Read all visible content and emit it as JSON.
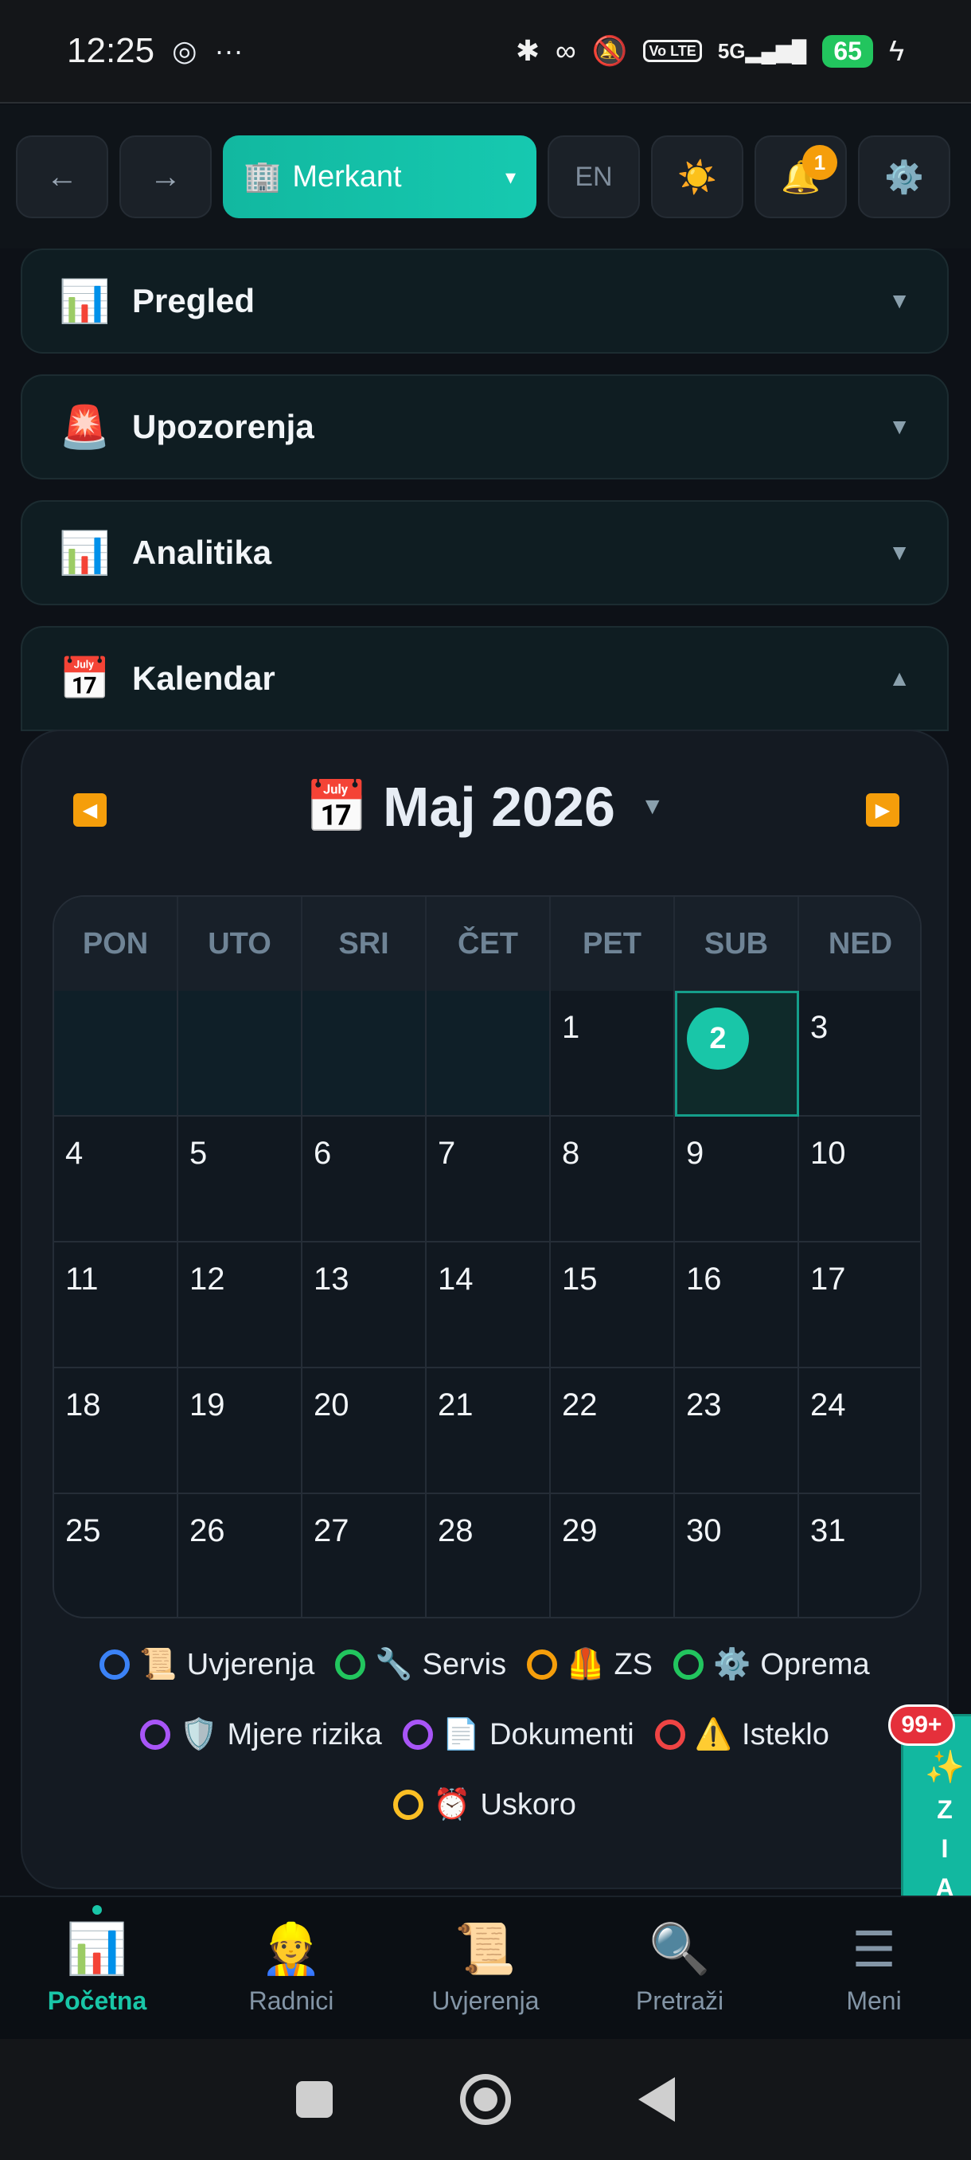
{
  "status_bar": {
    "time": "12:25",
    "icons": [
      "chrome-icon",
      "more-icon",
      "bluetooth-icon",
      "link-icon",
      "mute-icon",
      "volte-icon",
      "signal-5g-icon",
      "battery-icon",
      "charging-icon"
    ],
    "volte": "Vo LTE",
    "network": "5G",
    "battery": "65"
  },
  "topbar": {
    "back": "←",
    "forward": "→",
    "site_icon": "🏢",
    "site": "Merkant",
    "site_caret": "▾",
    "lang": "EN",
    "theme_icon": "☀️",
    "bell_icon": "🔔",
    "bell_badge": "1",
    "settings_icon": "⚙️"
  },
  "sections": [
    {
      "icon": "📊",
      "title": "Pregled",
      "caret": "▼"
    },
    {
      "icon": "🚨",
      "title": "Upozorenja",
      "caret": "▼"
    },
    {
      "icon": "📊",
      "title": "Analitika",
      "caret": "▼"
    },
    {
      "icon": "📅",
      "title": "Kalendar",
      "caret": "▲"
    }
  ],
  "calendar": {
    "prev": "◀",
    "next": "▶",
    "icon": "📅",
    "month_label": "Maj 2026",
    "month_caret": "▼",
    "weekdays": [
      "PON",
      "UTO",
      "SRI",
      "ČET",
      "PET",
      "SUB",
      "NED"
    ],
    "weeks": [
      [
        "",
        "",
        "",
        "",
        "1",
        "2",
        "3"
      ],
      [
        "4",
        "5",
        "6",
        "7",
        "8",
        "9",
        "10"
      ],
      [
        "11",
        "12",
        "13",
        "14",
        "15",
        "16",
        "17"
      ],
      [
        "18",
        "19",
        "20",
        "21",
        "22",
        "23",
        "24"
      ],
      [
        "25",
        "26",
        "27",
        "28",
        "29",
        "30",
        "31"
      ]
    ],
    "today": "2"
  },
  "legend": [
    {
      "color": "#3b82f6",
      "icon": "📜",
      "label": "Uvjerenja"
    },
    {
      "color": "#22c55e",
      "icon": "🔧",
      "label": "Servis"
    },
    {
      "color": "#f59e0b",
      "icon": "🦺",
      "label": "ZS"
    },
    {
      "color": "#22c55e",
      "icon": "⚙️",
      "label": "Oprema"
    },
    {
      "color": "#a855f7",
      "icon": "🛡️",
      "label": "Mjere rizika"
    },
    {
      "color": "#a855f7",
      "icon": "📄",
      "label": "Dokumenti"
    },
    {
      "color": "#ef4444",
      "icon": "⚠️",
      "label": "Isteklo"
    },
    {
      "color": "#fbbf24",
      "icon": "⏰",
      "label": "Uskoro"
    }
  ],
  "zia": {
    "badge": "99+",
    "icon": "✨",
    "letters": [
      "Z",
      "I",
      "A"
    ]
  },
  "bottom_nav": [
    {
      "icon": "📊",
      "label": "Početna",
      "active": true
    },
    {
      "icon": "👷",
      "label": "Radnici",
      "active": false
    },
    {
      "icon": "📜",
      "label": "Uvjerenja",
      "active": false
    },
    {
      "icon": "🔍",
      "label": "Pretraži",
      "active": false
    },
    {
      "icon": "☰",
      "label": "Meni",
      "active": false
    }
  ]
}
